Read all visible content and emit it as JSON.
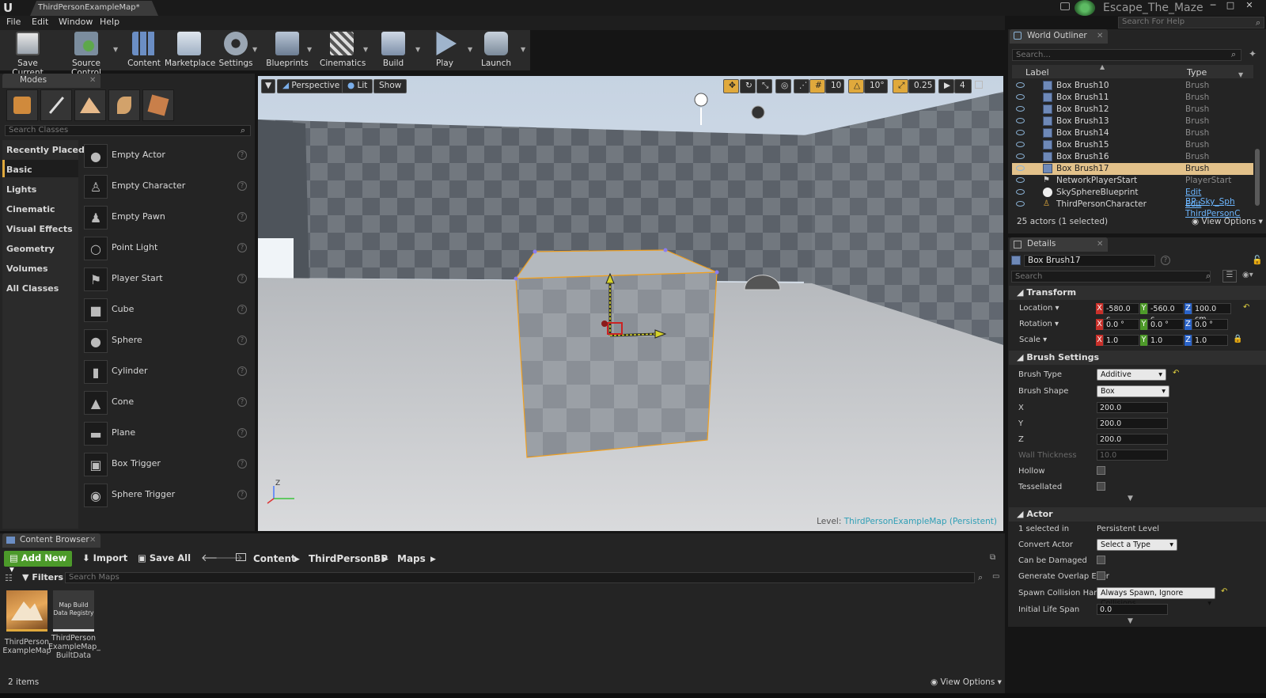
{
  "window": {
    "doc_tab": "ThirdPersonExampleMap*",
    "project_name": "Escape_The_Maze",
    "help_search_placeholder": "Search For Help"
  },
  "menu": [
    "File",
    "Edit",
    "Window",
    "Help"
  ],
  "toolbar": [
    {
      "label": "Save Current",
      "icon": "save-icon"
    },
    {
      "label": "Source Control",
      "icon": "source-control-icon"
    },
    {
      "label": "Content",
      "icon": "content-icon"
    },
    {
      "label": "Marketplace",
      "icon": "marketplace-icon"
    },
    {
      "label": "Settings",
      "icon": "settings-icon"
    },
    {
      "label": "Blueprints",
      "icon": "blueprints-icon"
    },
    {
      "label": "Cinematics",
      "icon": "cinematics-icon"
    },
    {
      "label": "Build",
      "icon": "build-icon"
    },
    {
      "label": "Play",
      "icon": "play-icon"
    },
    {
      "label": "Launch",
      "icon": "launch-icon"
    }
  ],
  "modes": {
    "tab": "Modes",
    "search_placeholder": "Search Classes",
    "categories": [
      "Recently Placed",
      "Basic",
      "Lights",
      "Cinematic",
      "Visual Effects",
      "Geometry",
      "Volumes",
      "All Classes"
    ],
    "selected_category": "Basic",
    "items": [
      "Empty Actor",
      "Empty Character",
      "Empty Pawn",
      "Point Light",
      "Player Start",
      "Cube",
      "Sphere",
      "Cylinder",
      "Cone",
      "Plane",
      "Box Trigger",
      "Sphere Trigger"
    ]
  },
  "viewport": {
    "view_mode": "Perspective",
    "lighting": "Lit",
    "show": "Show",
    "grid_snap": "10",
    "rotation_snap": "10°",
    "scale_snap": "0.25",
    "camera_speed": "4",
    "level_prefix": "Level:",
    "level_name": "ThirdPersonExampleMap (Persistent)",
    "axis_z": "Z"
  },
  "outliner": {
    "tab": "World Outliner",
    "search_placeholder": "Search...",
    "col_label": "Label",
    "col_type": "Type",
    "rows": [
      {
        "label": "Box Brush10",
        "type": "Brush"
      },
      {
        "label": "Box Brush11",
        "type": "Brush"
      },
      {
        "label": "Box Brush12",
        "type": "Brush"
      },
      {
        "label": "Box Brush13",
        "type": "Brush"
      },
      {
        "label": "Box Brush14",
        "type": "Brush"
      },
      {
        "label": "Box Brush15",
        "type": "Brush"
      },
      {
        "label": "Box Brush16",
        "type": "Brush"
      },
      {
        "label": "Box Brush17",
        "type": "Brush"
      },
      {
        "label": "NetworkPlayerStart",
        "type": "PlayerStart"
      },
      {
        "label": "SkySphereBlueprint",
        "type": "Edit BP_Sky_Sph"
      },
      {
        "label": "ThirdPersonCharacter",
        "type": "Edit ThirdPersonC"
      }
    ],
    "selected_row": "Box Brush17",
    "status": "25 actors (1 selected)",
    "view_options": "View Options"
  },
  "details": {
    "tab": "Details",
    "object_name": "Box Brush17",
    "search_placeholder": "Search",
    "transform": {
      "title": "Transform",
      "location_label": "Location",
      "rotation_label": "Rotation",
      "scale_label": "Scale",
      "location": [
        "-580.0 c",
        "-560.0 c",
        "100.0 cm"
      ],
      "rotation": [
        "0.0 °",
        "0.0 °",
        "0.0 °"
      ],
      "scale": [
        "1.0",
        "1.0",
        "1.0"
      ]
    },
    "brush": {
      "title": "Brush Settings",
      "type_label": "Brush Type",
      "type_value": "Additive",
      "shape_label": "Brush Shape",
      "shape_value": "Box",
      "x_label": "X",
      "x_value": "200.0",
      "y_label": "Y",
      "y_value": "200.0",
      "z_label": "Z",
      "z_value": "200.0",
      "wall_label": "Wall Thickness",
      "wall_value": "10.0",
      "hollow_label": "Hollow",
      "tess_label": "Tessellated"
    },
    "actor": {
      "title": "Actor",
      "selected_in_label": "1 selected in",
      "selected_in_value": "Persistent Level",
      "convert_label": "Convert Actor",
      "convert_value": "Select a Type",
      "damage_label": "Can be Damaged",
      "overlap_label": "Generate Overlap Ever",
      "spawn_label": "Spawn Collision Handl",
      "spawn_value": "Always Spawn, Ignore Collisions",
      "life_label": "Initial Life Span",
      "life_value": "0.0"
    }
  },
  "content_browser": {
    "tab": "Content Browser",
    "add_new": "Add New",
    "import": "Import",
    "save_all": "Save All",
    "path": [
      "Content",
      "ThirdPersonBP",
      "Maps"
    ],
    "filters": "Filters",
    "search_placeholder": "Search Maps",
    "assets": [
      {
        "label": "ThirdPerson ExampleMap",
        "thumb": ""
      },
      {
        "label": "ThirdPerson ExampleMap_ BuiltData",
        "thumb": "Map Build Data Registry"
      }
    ],
    "item_count": "2 items",
    "view_options": "View Options"
  },
  "colors": {
    "accent_selection": "#e2c18a",
    "add_new_green": "#4c9a2a",
    "brush_outline": "#f0a020",
    "level_name": "#5fc5d8"
  }
}
